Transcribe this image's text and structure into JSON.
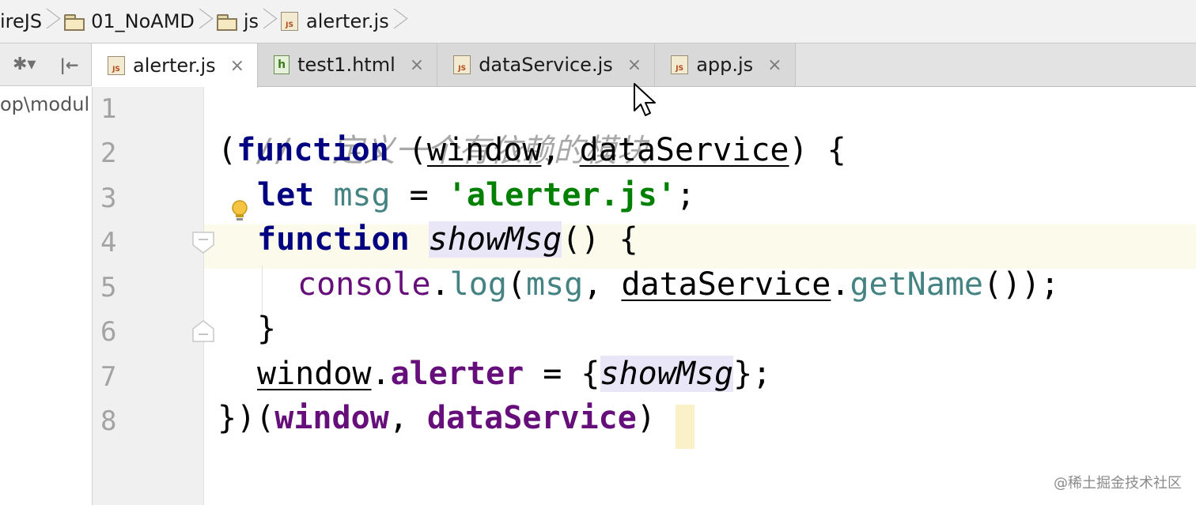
{
  "breadcrumb": {
    "items": [
      {
        "label": "ireJS",
        "icon": "none"
      },
      {
        "label": "01_NoAMD",
        "icon": "folder-icon"
      },
      {
        "label": "js",
        "icon": "folder-icon"
      },
      {
        "label": "alerter.js",
        "icon": "js-file-icon"
      }
    ]
  },
  "tabs": [
    {
      "label": "alerter.js",
      "icon": "js-file-icon",
      "active": true
    },
    {
      "label": "test1.html",
      "icon": "html-file-icon",
      "active": false
    },
    {
      "label": "dataService.js",
      "icon": "js-file-icon",
      "active": false
    },
    {
      "label": "app.js",
      "icon": "js-file-icon",
      "active": false
    }
  ],
  "tab_close_glyph": "×",
  "js_icon_text": "JS",
  "html_icon_text": "h",
  "project": {
    "path": "op\\modul"
  },
  "editor": {
    "current_line": 4,
    "line_numbers": [
      "1",
      "2",
      "3",
      "4",
      "5",
      "6",
      "7",
      "8"
    ],
    "lines": {
      "l1": {
        "comment": "//  定义一个有依赖的模块"
      },
      "l2": {
        "p1": "(",
        "kw": "function",
        "p2": " (",
        "a1": "window",
        "p3": ", ",
        "a2": "dataService",
        "p4": ") {"
      },
      "l3": {
        "kw": "let",
        "sp": " ",
        "var": "msg",
        "eq": " = ",
        "str": "'alerter.js'",
        "end": ";"
      },
      "l4": {
        "kw": "function",
        "sp": " ",
        "name": "showMsg",
        "end": "() {"
      },
      "l5": {
        "obj": "console",
        "dot": ".",
        "meth": "log",
        "p1": "(",
        "arg1": "msg",
        "p2": ", ",
        "arg2": "dataService",
        "dot2": ".",
        "meth2": "getName",
        "end": "());"
      },
      "l6": {
        "brace": "}"
      },
      "l7": {
        "obj": "window",
        "dot": ".",
        "prop": "alerter",
        "eq": " = {",
        "val": "showMsg",
        "end": "};"
      },
      "l8": {
        "p1": "})(",
        "a1": "window",
        "p2": ", ",
        "a2": "dataService",
        "p3": ")"
      }
    }
  },
  "watermark": "@稀土掘金技术社区",
  "colors": {
    "keyword": "#000080",
    "string": "#008000",
    "comment": "#a8a8a8",
    "global": "#660e7a",
    "param": "#458383",
    "current_line_bg": "#fcfaeb"
  }
}
